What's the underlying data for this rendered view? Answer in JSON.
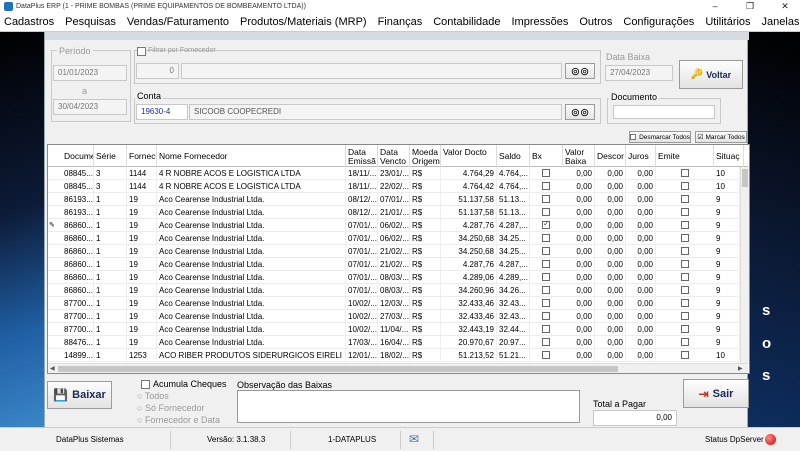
{
  "window": {
    "title": "DataPlus ERP (1 - PRIME BOMBAS  (PRIME EQUIPAMENTOS DE BOMBEAMENTO LTDA))",
    "minimize": "–",
    "maximize": "❐",
    "close": "✕"
  },
  "menu": [
    "Cadastros",
    "Pesquisas",
    "Vendas/Faturamento",
    "Produtos/Materiais (MRP)",
    "Finanças",
    "Contabilidade",
    "Impressões",
    "Outros",
    "Configurações",
    "Utilitários",
    "Janelas"
  ],
  "background": {
    "right_text": [
      "s",
      "o",
      "s"
    ]
  },
  "filters": {
    "periodo_label": "Período",
    "date_from": "01/01/2023",
    "date_sep": "a",
    "date_to": "30/04/2023",
    "filtrar_fornecedor_label": "Filtrar por Fornecedor",
    "fornecedor_code": "0",
    "data_baixa_label": "Data Baixa",
    "data_baixa": "27/04/2023",
    "voltar_label": "Voltar",
    "conta_label": "Conta",
    "conta_code": "19630-4",
    "conta_name": "SICOOB COOPECREDI",
    "documento_label": "Documento",
    "documento_value": "",
    "desmarcar_label": "Desmarcar Todos",
    "marcar_label": "Marcar Todos"
  },
  "table": {
    "columns": [
      "Docume",
      "Série",
      "Fornece",
      "Nome Fornecedor",
      "Data Emissã",
      "Data Vencto",
      "Moeda Origem",
      "Valor Docto",
      "Saldo",
      "Bx",
      "Valor Baixa",
      "Descor",
      "Juros",
      "Emite Cheque",
      "Situaç"
    ],
    "rows": [
      {
        "doc": "08845...",
        "serie": "3",
        "forn": "1144",
        "nome": "4 R NOBRE ACOS E LOGISTICA LTDA",
        "emissao": "18/11/...",
        "vencto": "23/01/...",
        "moeda": "R$",
        "valor": "4.764,29",
        "saldo": "4.764,...",
        "bx": false,
        "vbaixa": "0,00",
        "desc": "0,00",
        "juros": "0,00",
        "cheque": false,
        "sit": "10",
        "current": false
      },
      {
        "doc": "08845...",
        "serie": "3",
        "forn": "1144",
        "nome": "4 R NOBRE ACOS E LOGISTICA LTDA",
        "emissao": "18/11/...",
        "vencto": "22/02/...",
        "moeda": "R$",
        "valor": "4.764,42",
        "saldo": "4.764,...",
        "bx": false,
        "vbaixa": "0,00",
        "desc": "0,00",
        "juros": "0,00",
        "cheque": false,
        "sit": "10",
        "current": false
      },
      {
        "doc": "86193...",
        "serie": "1",
        "forn": "19",
        "nome": "Aco Cearense Industrial Ltda.",
        "emissao": "08/12/...",
        "vencto": "07/01/...",
        "moeda": "R$",
        "valor": "51.137,58",
        "saldo": "51.13...",
        "bx": false,
        "vbaixa": "0,00",
        "desc": "0,00",
        "juros": "0,00",
        "cheque": false,
        "sit": "9",
        "current": false
      },
      {
        "doc": "86193...",
        "serie": "1",
        "forn": "19",
        "nome": "Aco Cearense Industrial Ltda.",
        "emissao": "08/12/...",
        "vencto": "21/01/...",
        "moeda": "R$",
        "valor": "51.137,58",
        "saldo": "51.13...",
        "bx": false,
        "vbaixa": "0,00",
        "desc": "0,00",
        "juros": "0,00",
        "cheque": false,
        "sit": "9",
        "current": false
      },
      {
        "doc": "86860...",
        "serie": "1",
        "forn": "19",
        "nome": "Aco Cearense Industrial Ltda.",
        "emissao": "07/01/...",
        "vencto": "06/02/...",
        "moeda": "R$",
        "valor": "4.287,76",
        "saldo": "4.287,...",
        "bx": true,
        "vbaixa": "0,00",
        "desc": "0,00",
        "juros": "0,00",
        "cheque": false,
        "sit": "9",
        "current": true
      },
      {
        "doc": "86860...",
        "serie": "1",
        "forn": "19",
        "nome": "Aco Cearense Industrial Ltda.",
        "emissao": "07/01/...",
        "vencto": "06/02/...",
        "moeda": "R$",
        "valor": "34.250,68",
        "saldo": "34.25...",
        "bx": false,
        "vbaixa": "0,00",
        "desc": "0,00",
        "juros": "0,00",
        "cheque": false,
        "sit": "9",
        "current": false
      },
      {
        "doc": "86860...",
        "serie": "1",
        "forn": "19",
        "nome": "Aco Cearense Industrial Ltda.",
        "emissao": "07/01/...",
        "vencto": "21/02/...",
        "moeda": "R$",
        "valor": "34.250,68",
        "saldo": "34.25...",
        "bx": false,
        "vbaixa": "0,00",
        "desc": "0,00",
        "juros": "0,00",
        "cheque": false,
        "sit": "9",
        "current": false
      },
      {
        "doc": "86860...",
        "serie": "1",
        "forn": "19",
        "nome": "Aco Cearense Industrial Ltda.",
        "emissao": "07/01/...",
        "vencto": "21/02/...",
        "moeda": "R$",
        "valor": "4.287,76",
        "saldo": "4.287,...",
        "bx": false,
        "vbaixa": "0,00",
        "desc": "0,00",
        "juros": "0,00",
        "cheque": false,
        "sit": "9",
        "current": false
      },
      {
        "doc": "86860...",
        "serie": "1",
        "forn": "19",
        "nome": "Aco Cearense Industrial Ltda.",
        "emissao": "07/01/...",
        "vencto": "08/03/...",
        "moeda": "R$",
        "valor": "4.289,06",
        "saldo": "4.289,...",
        "bx": false,
        "vbaixa": "0,00",
        "desc": "0,00",
        "juros": "0,00",
        "cheque": false,
        "sit": "9",
        "current": false
      },
      {
        "doc": "86860...",
        "serie": "1",
        "forn": "19",
        "nome": "Aco Cearense Industrial Ltda.",
        "emissao": "07/01/...",
        "vencto": "08/03/...",
        "moeda": "R$",
        "valor": "34.260,96",
        "saldo": "34.26...",
        "bx": false,
        "vbaixa": "0,00",
        "desc": "0,00",
        "juros": "0,00",
        "cheque": false,
        "sit": "9",
        "current": false
      },
      {
        "doc": "87700...",
        "serie": "1",
        "forn": "19",
        "nome": "Aco Cearense Industrial Ltda.",
        "emissao": "10/02/...",
        "vencto": "12/03/...",
        "moeda": "R$",
        "valor": "32.433,46",
        "saldo": "32.43...",
        "bx": false,
        "vbaixa": "0,00",
        "desc": "0,00",
        "juros": "0,00",
        "cheque": false,
        "sit": "9",
        "current": false
      },
      {
        "doc": "87700...",
        "serie": "1",
        "forn": "19",
        "nome": "Aco Cearense Industrial Ltda.",
        "emissao": "10/02/...",
        "vencto": "27/03/...",
        "moeda": "R$",
        "valor": "32.433,46",
        "saldo": "32.43...",
        "bx": false,
        "vbaixa": "0,00",
        "desc": "0,00",
        "juros": "0,00",
        "cheque": false,
        "sit": "9",
        "current": false
      },
      {
        "doc": "87700...",
        "serie": "1",
        "forn": "19",
        "nome": "Aco Cearense Industrial Ltda.",
        "emissao": "10/02/...",
        "vencto": "11/04/...",
        "moeda": "R$",
        "valor": "32.443,19",
        "saldo": "32.44...",
        "bx": false,
        "vbaixa": "0,00",
        "desc": "0,00",
        "juros": "0,00",
        "cheque": false,
        "sit": "9",
        "current": false
      },
      {
        "doc": "88476...",
        "serie": "1",
        "forn": "19",
        "nome": "Aco Cearense Industrial Ltda.",
        "emissao": "17/03/...",
        "vencto": "16/04/...",
        "moeda": "R$",
        "valor": "20.970,67",
        "saldo": "20.97...",
        "bx": false,
        "vbaixa": "0,00",
        "desc": "0,00",
        "juros": "0,00",
        "cheque": false,
        "sit": "9",
        "current": false
      },
      {
        "doc": "14899...",
        "serie": "1",
        "forn": "1253",
        "nome": "ACO RIBER PRODUTOS SIDERURGICOS EIRELI",
        "emissao": "12/01/...",
        "vencto": "18/02/...",
        "moeda": "R$",
        "valor": "51.213,52",
        "saldo": "51.21...",
        "bx": false,
        "vbaixa": "0,00",
        "desc": "0,00",
        "juros": "0,00",
        "cheque": false,
        "sit": "10",
        "current": false
      }
    ]
  },
  "bottom": {
    "baixar_label": "Baixar",
    "acumula_label": "Acumula Cheques",
    "radio_todos": "Todos",
    "radio_fornecedor": "Só Fornecedor",
    "radio_forn_data": "Fornecedor e Data",
    "obs_label": "Observação das Baixas",
    "total_label": "Total a Pagar",
    "total_value": "0,00",
    "sair_label": "Sair"
  },
  "status": {
    "app": "DataPlus Sistemas",
    "version": "Versão: 3.1.38.3",
    "company": "1-DATAPLUS",
    "server": "Status DpServer"
  }
}
